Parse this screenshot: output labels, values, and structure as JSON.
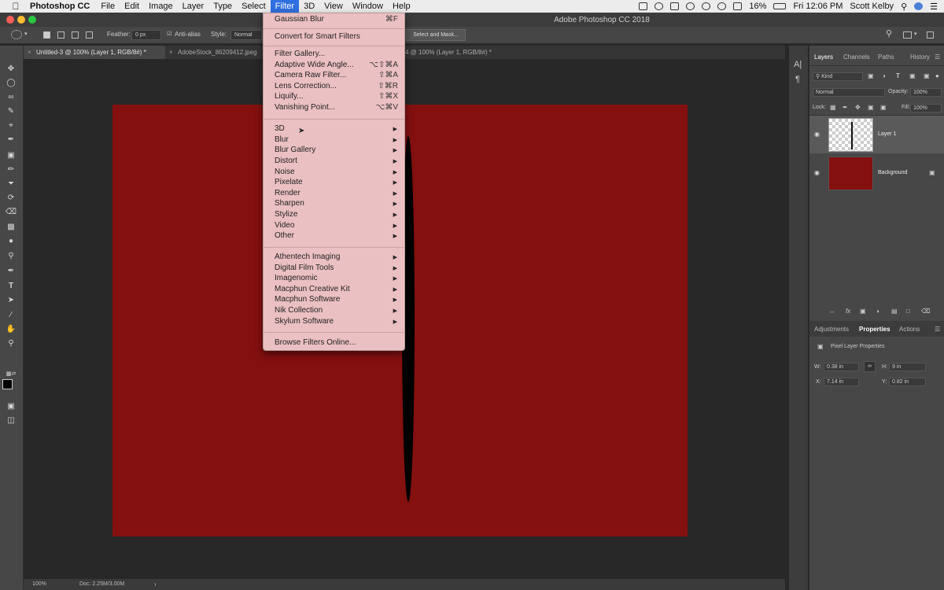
{
  "menubar": {
    "app_name": "Photoshop CC",
    "items": [
      "File",
      "Edit",
      "Image",
      "Layer",
      "Type",
      "Select",
      "Filter",
      "3D",
      "View",
      "Window",
      "Help"
    ],
    "active_item": "Filter",
    "battery": "16%",
    "clock": "Fri 12:06 PM",
    "user": "Scott Kelby"
  },
  "window": {
    "title": "Adobe Photoshop CC 2018"
  },
  "options": {
    "feather_label": "Feather:",
    "feather_value": "0 px",
    "antialias_label": "Anti-alias",
    "style_label": "Style:",
    "style_value": "Normal",
    "select_mask_label": "Select and Mask..."
  },
  "tabs": [
    {
      "label": "Untitled-3 @ 100% (Layer 1, RGB/8#) *",
      "active": true
    },
    {
      "label": "AdobeStock_86209412.jpeg",
      "active": false
    },
    {
      "label": "4 @ 100% (Layer 1, RGB/8#) *",
      "active": false
    }
  ],
  "filter_menu": {
    "gaussian_blur": {
      "label": "Gaussian Blur",
      "shortcut": "⌘F"
    },
    "convert_smart": {
      "label": "Convert for Smart Filters"
    },
    "group1": [
      {
        "label": "Filter Gallery...",
        "shortcut": ""
      },
      {
        "label": "Adaptive Wide Angle...",
        "shortcut": "⌥⇧⌘A"
      },
      {
        "label": "Camera Raw Filter...",
        "shortcut": "⇧⌘A"
      },
      {
        "label": "Lens Correction...",
        "shortcut": "⇧⌘R"
      },
      {
        "label": "Liquify...",
        "shortcut": "⇧⌘X"
      },
      {
        "label": "Vanishing Point...",
        "shortcut": "⌥⌘V"
      }
    ],
    "group2": [
      "3D",
      "Blur",
      "Blur Gallery",
      "Distort",
      "Noise",
      "Pixelate",
      "Render",
      "Sharpen",
      "Stylize",
      "Video",
      "Other"
    ],
    "group3": [
      "Athentech Imaging",
      "Digital Film Tools",
      "Imagenomic",
      "Macphun Creative Kit",
      "Macphun Software",
      "Nik Collection",
      "Skylum Software"
    ],
    "browse": {
      "label": "Browse Filters Online..."
    }
  },
  "layers_panel": {
    "tabs": [
      "Layers",
      "Channels",
      "Paths",
      "History"
    ],
    "active_tab": "Layers",
    "kind_label": "Kind",
    "blend_mode": "Normal",
    "opacity_label": "Opacity:",
    "opacity_value": "100%",
    "lock_label": "Lock:",
    "fill_label": "Fill:",
    "fill_value": "100%",
    "layers": [
      {
        "name": "Layer 1",
        "selected": true
      },
      {
        "name": "Background",
        "selected": false
      }
    ]
  },
  "properties_panel": {
    "tabs": [
      "Adjustments",
      "Properties",
      "Actions"
    ],
    "active_tab": "Properties",
    "title": "Pixel Layer Properties",
    "w_label": "W:",
    "w_value": "0.38 in",
    "h_label": "H:",
    "h_value": "9 in",
    "x_label": "X:",
    "x_value": "7.14 in",
    "y_label": "Y:",
    "y_value": "0.82 in"
  },
  "status": {
    "zoom": "100%",
    "doc": "Doc: 2.25M/3.00M"
  },
  "colors": {
    "document_fill": "#841010",
    "menu_bg": "#ebc0c2",
    "accent": "#2f6fe0"
  }
}
